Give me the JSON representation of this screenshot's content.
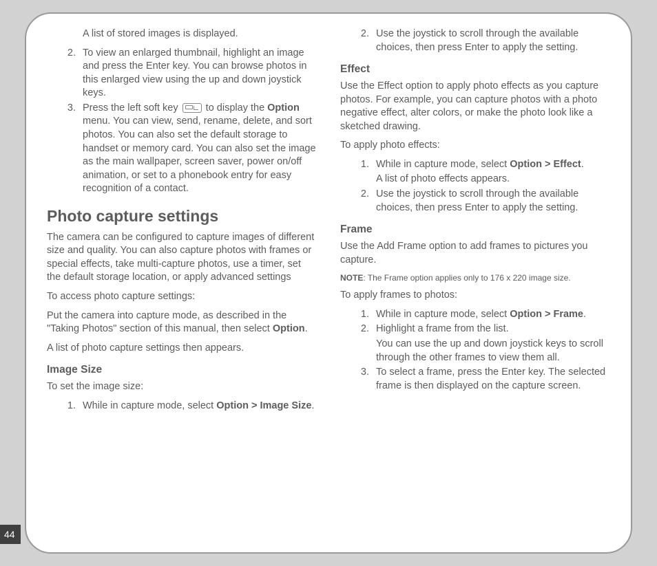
{
  "page_number": "44",
  "left": {
    "intro_line": "A list of stored images is displayed.",
    "list_top": [
      "To view an enlarged thumbnail, highlight an image and press the Enter key. You can browse photos in this enlarged view using the up and down joystick keys.",
      {
        "pre": "Press the left soft key ",
        "post_pre": " to display the ",
        "bold": "Option",
        "post": " menu. You can view, send, rename, delete, and sort photos. You can also set the default storage to handset or memory card. You can also set the image as the main wallpaper, screen saver, power on/off animation, or set to a phonebook entry for easy recognition of a contact."
      }
    ],
    "h2": "Photo capture settings",
    "p1": "The camera can be configured to capture images of different size and quality. You can also capture photos with frames or special effects, take multi-capture photos, use a timer, set the default storage location, or apply advanced settings",
    "p2": "To access photo capture settings:",
    "p3_pre": "Put the camera into capture mode, as described in the \"Taking Photos\" section of this manual, then select ",
    "p3_bold": "Option",
    "p3_post": ".",
    "p4": "A list of photo capture settings then appears.",
    "h3_imgsize": "Image Size",
    "imgsize_intro": "To set the image size:",
    "imgsize_item_pre": "While in capture mode, select ",
    "imgsize_item_bold": "Option > Image Size",
    "imgsize_item_post": "."
  },
  "right": {
    "top_item": "Use the joystick to scroll through the available choices, then press Enter to apply the setting.",
    "h3_effect": "Effect",
    "effect_p": "Use the Effect option to apply photo effects as you capture photos. For example, you can capture photos with a photo negative effect, alter colors, or make the photo look like a sketched drawing.",
    "effect_intro": "To apply photo effects:",
    "effect_li1_pre": "While in capture mode, select ",
    "effect_li1_bold": "Option > Effect",
    "effect_li1_post": ".",
    "effect_li1_sub": "A list of photo effects appears.",
    "effect_li2": "Use the joystick to scroll through the available choices, then press Enter to apply the setting.",
    "h3_frame": "Frame",
    "frame_p": "Use the Add Frame option to add frames to pictures you capture.",
    "note_bold": "NOTE",
    "note_rest": ": The Frame option applies only to 176 x  220 image size.",
    "frame_intro": "To apply frames to photos:",
    "frame_li1_pre": "While in capture mode, select ",
    "frame_li1_bold": "Option > Frame",
    "frame_li1_post": ".",
    "frame_li2": "Highlight a frame from the list.",
    "frame_li2_sub": "You can use the up and down joystick keys to scroll through the other frames to view them all.",
    "frame_li3": "To select a frame, press the Enter key. The selected frame is then displayed on the capture screen."
  }
}
